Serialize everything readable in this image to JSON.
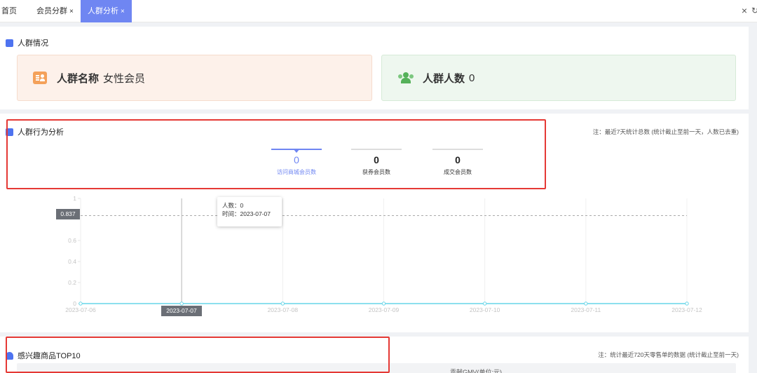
{
  "tabs": [
    {
      "label": "首页",
      "closable": false,
      "active": false
    },
    {
      "label": "会员分群",
      "closable": true,
      "active": false
    },
    {
      "label": "人群分析",
      "closable": true,
      "active": true
    }
  ],
  "tab_close_glyph": "×",
  "close_all_glyph": "×",
  "crowd_info": {
    "title": "人群情况",
    "name_label": "人群名称",
    "name_value": "女性会员",
    "count_label": "人群人数",
    "count_value": "0"
  },
  "behavior": {
    "title": "人群行为分析",
    "note": "注：最近7天统计总数 (统计截止至前一天，人数已去重)",
    "metrics": [
      {
        "value": "0",
        "label": "访问商城会员数",
        "active": true
      },
      {
        "value": "0",
        "label": "获券会员数",
        "active": false
      },
      {
        "value": "0",
        "label": "成交会员数",
        "active": false
      }
    ]
  },
  "tooltip": {
    "count_label": "人数：",
    "count_value": "0",
    "time_label": "时间：",
    "time_value": "2023-07-07"
  },
  "chart_data": {
    "type": "line",
    "x": [
      "2023-07-06",
      "2023-07-07",
      "2023-07-08",
      "2023-07-09",
      "2023-07-10",
      "2023-07-11",
      "2023-07-12"
    ],
    "series": [
      {
        "values": [
          0,
          0,
          0,
          0,
          0,
          0,
          0
        ],
        "color": "#67d6e8"
      }
    ],
    "y_ticks": [
      "0",
      "0.2",
      "0.4",
      "0.6",
      "0.837",
      "1"
    ],
    "ylim": [
      0,
      1
    ],
    "grid": true,
    "crosshair_x": "2023-07-07",
    "crosshair_y": "0.837",
    "xlabel": "",
    "ylabel": ""
  },
  "top10": {
    "title": "感兴趣商品TOP10",
    "note": "注：统计最近720天零售单的数据 (统计截止至前一天)",
    "column_gmv": "贡献GMV(单位:元)"
  },
  "colors": {
    "accent": "#6f86f2",
    "highlight_box": "#e53935",
    "card_name_bg": "#fdf1ea",
    "card_count_bg": "#eef7ef",
    "line": "#67d6e8"
  }
}
